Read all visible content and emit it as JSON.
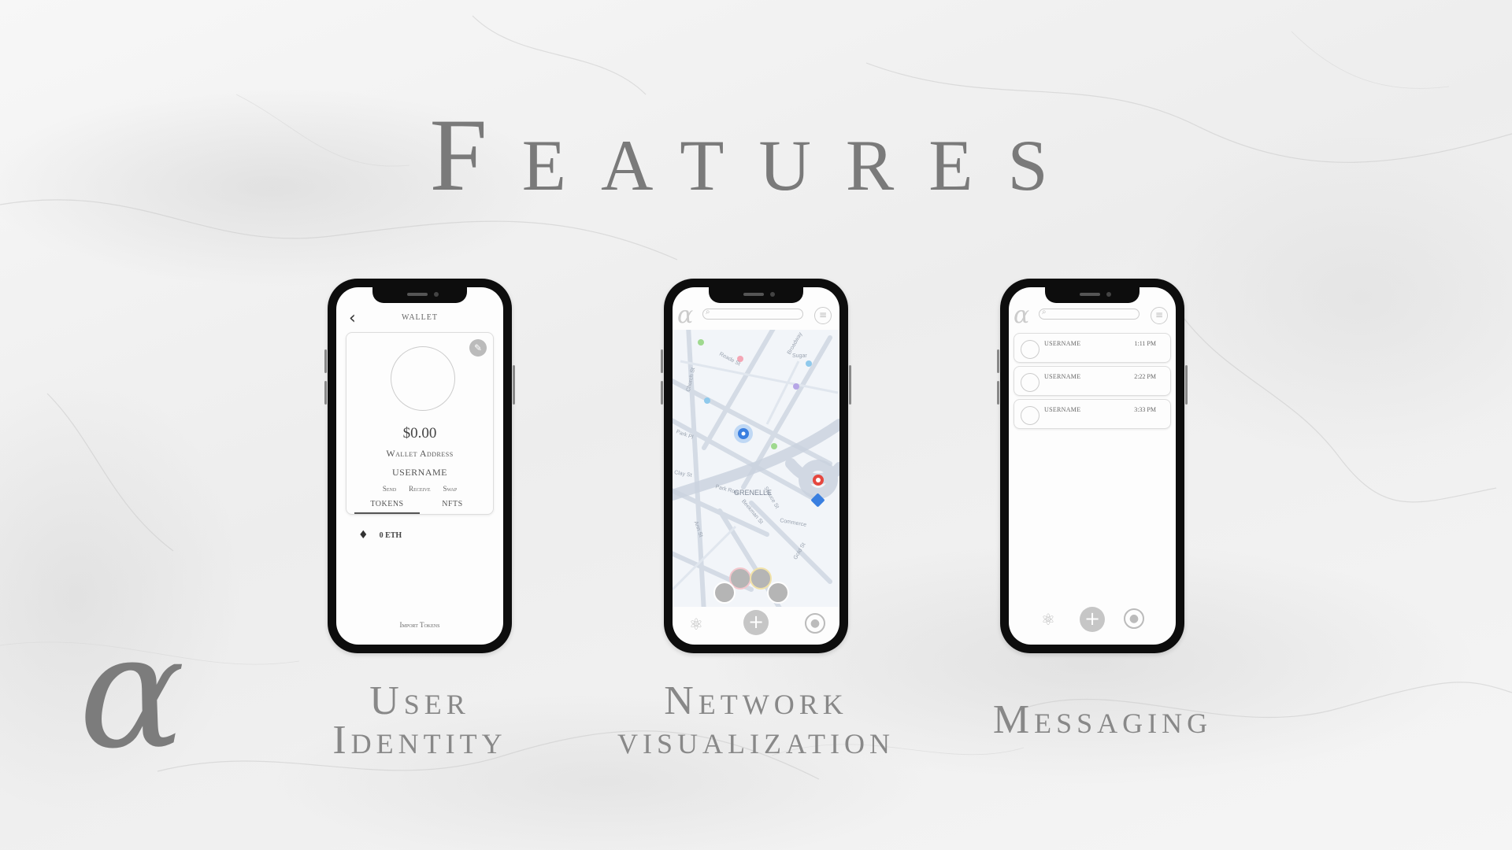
{
  "title": "Features",
  "logo": "α",
  "phones": {
    "wallet": {
      "back_icon": "chevron-left-icon",
      "header": "WALLET",
      "edit_icon": "edit-icon",
      "balance": "$0.00",
      "wallet_address": "Wallet Address",
      "username": "USERNAME",
      "actions": [
        "Send",
        "Receive",
        "Swap"
      ],
      "tabs": [
        "TOKENS",
        "NFTS"
      ],
      "token_icon": "ethereum-icon",
      "token_amount": "0 ETH",
      "import_tokens": "Import Tokens"
    },
    "network": {
      "header_logo": "α",
      "search_icon": "search-icon",
      "menu_icon": "menu-icon",
      "map_labels": [
        "Broadway",
        "Reade St",
        "Church St",
        "Park Pl",
        "Park Row",
        "Spruce St",
        "Beekman St",
        "Ann St",
        "Gold St",
        "Sugar",
        "Commerce",
        "Clay St"
      ],
      "place_label": "GRENELLE",
      "nav_icons": [
        "network-icon",
        "add-icon",
        "profile-icon"
      ]
    },
    "messaging": {
      "header_logo": "α",
      "search_icon": "search-icon",
      "menu_icon": "menu-icon",
      "messages": [
        {
          "name": "USERNAME",
          "time": "1:11 PM"
        },
        {
          "name": "USERNAME",
          "time": "2:22 PM"
        },
        {
          "name": "USERNAME",
          "time": "3:33 PM"
        }
      ],
      "nav_icons": [
        "network-icon",
        "add-icon",
        "profile-icon"
      ]
    }
  },
  "captions": {
    "user_identity": [
      "User",
      "Identity"
    ],
    "network_visualization": [
      "Network",
      "visualization"
    ],
    "messaging": [
      "Messaging"
    ]
  }
}
